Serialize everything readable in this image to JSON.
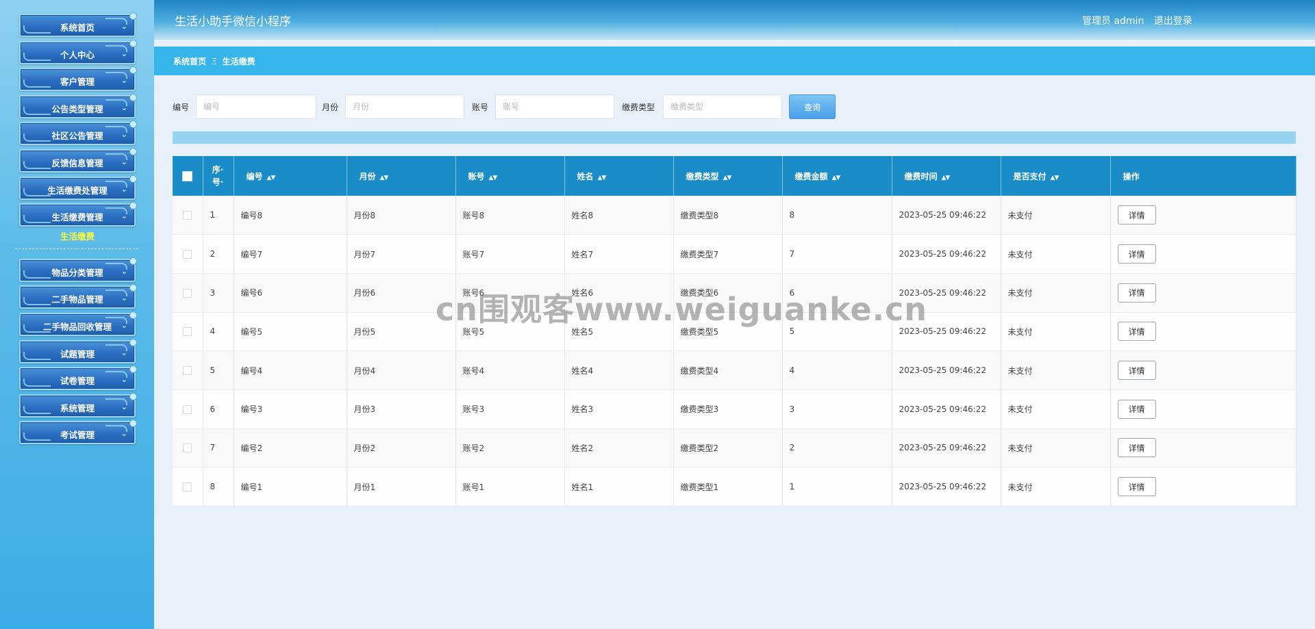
{
  "sidebar": {
    "items_top": [
      {
        "label": "系统首页"
      },
      {
        "label": "个人中心"
      },
      {
        "label": "客户管理"
      },
      {
        "label": "公告类型管理"
      },
      {
        "label": "社区公告管理"
      },
      {
        "label": "反馈信息管理"
      },
      {
        "label": "生活缴费处管理"
      },
      {
        "label": "生活缴费管理"
      }
    ],
    "submenu": {
      "label": "生活缴费"
    },
    "items_bottom": [
      {
        "label": "物品分类管理"
      },
      {
        "label": "二手物品管理"
      },
      {
        "label": "二手物品回收管理"
      },
      {
        "label": "试题管理"
      },
      {
        "label": "试卷管理"
      },
      {
        "label": "系统管理"
      },
      {
        "label": "考试管理"
      }
    ]
  },
  "header": {
    "title": "生活小助手微信小程序",
    "admin_label": "管理员 admin",
    "logout_label": "退出登录"
  },
  "breadcrumb": {
    "home": "系统首页",
    "separator": "Ξ",
    "current": "生活缴费"
  },
  "search": {
    "fields": [
      {
        "label": "编号",
        "placeholder": "编号",
        "value": ""
      },
      {
        "label": "月份",
        "placeholder": "月份",
        "value": ""
      },
      {
        "label": "账号",
        "placeholder": "账号",
        "value": ""
      },
      {
        "label": "缴费类型",
        "placeholder": "缴费类型",
        "value": ""
      }
    ],
    "query_label": "查询"
  },
  "table": {
    "columns": {
      "seq_line1": "序·",
      "seq_line2": "号·",
      "code": "编号",
      "month": "月份",
      "account": "账号",
      "name": "姓名",
      "fee_type": "缴费类型",
      "amount": "缴费金额",
      "time": "缴费时间",
      "paid": "是否支付",
      "action": "操作"
    },
    "sort_icon": "sort-arrows-icon",
    "detail_label": "详情",
    "rows": [
      {
        "seq": "1",
        "code": "编号8",
        "month": "月份8",
        "account": "账号8",
        "name": "姓名8",
        "fee_type": "缴费类型8",
        "amount": "8",
        "time": "2023-05-25 09:46:22",
        "paid": "未支付"
      },
      {
        "seq": "2",
        "code": "编号7",
        "month": "月份7",
        "account": "账号7",
        "name": "姓名7",
        "fee_type": "缴费类型7",
        "amount": "7",
        "time": "2023-05-25 09:46:22",
        "paid": "未支付"
      },
      {
        "seq": "3",
        "code": "编号6",
        "month": "月份6",
        "account": "账号6",
        "name": "姓名6",
        "fee_type": "缴费类型6",
        "amount": "6",
        "time": "2023-05-25 09:46:22",
        "paid": "未支付"
      },
      {
        "seq": "4",
        "code": "编号5",
        "month": "月份5",
        "account": "账号5",
        "name": "姓名5",
        "fee_type": "缴费类型5",
        "amount": "5",
        "time": "2023-05-25 09:46:22",
        "paid": "未支付"
      },
      {
        "seq": "5",
        "code": "编号4",
        "month": "月份4",
        "account": "账号4",
        "name": "姓名4",
        "fee_type": "缴费类型4",
        "amount": "4",
        "time": "2023-05-25 09:46:22",
        "paid": "未支付"
      },
      {
        "seq": "6",
        "code": "编号3",
        "month": "月份3",
        "account": "账号3",
        "name": "姓名3",
        "fee_type": "缴费类型3",
        "amount": "3",
        "time": "2023-05-25 09:46:22",
        "paid": "未支付"
      },
      {
        "seq": "7",
        "code": "编号2",
        "month": "月份2",
        "account": "账号2",
        "name": "姓名2",
        "fee_type": "缴费类型2",
        "amount": "2",
        "time": "2023-05-25 09:46:22",
        "paid": "未支付"
      },
      {
        "seq": "8",
        "code": "编号1",
        "month": "月份1",
        "account": "账号1",
        "name": "姓名1",
        "fee_type": "缴费类型1",
        "amount": "1",
        "time": "2023-05-25 09:46:22",
        "paid": "未支付"
      }
    ]
  },
  "watermark": "cn围观客www.weiguanke.cn",
  "colors": {
    "sidebar_bg": "#5bbbe9",
    "header_bg": "#1e84c4",
    "breadcrumb_bg": "#35b5ea",
    "table_header_bg": "#1a8cc7",
    "submenu_active": "#ffff3a",
    "query_button": "#4a9fe8"
  }
}
